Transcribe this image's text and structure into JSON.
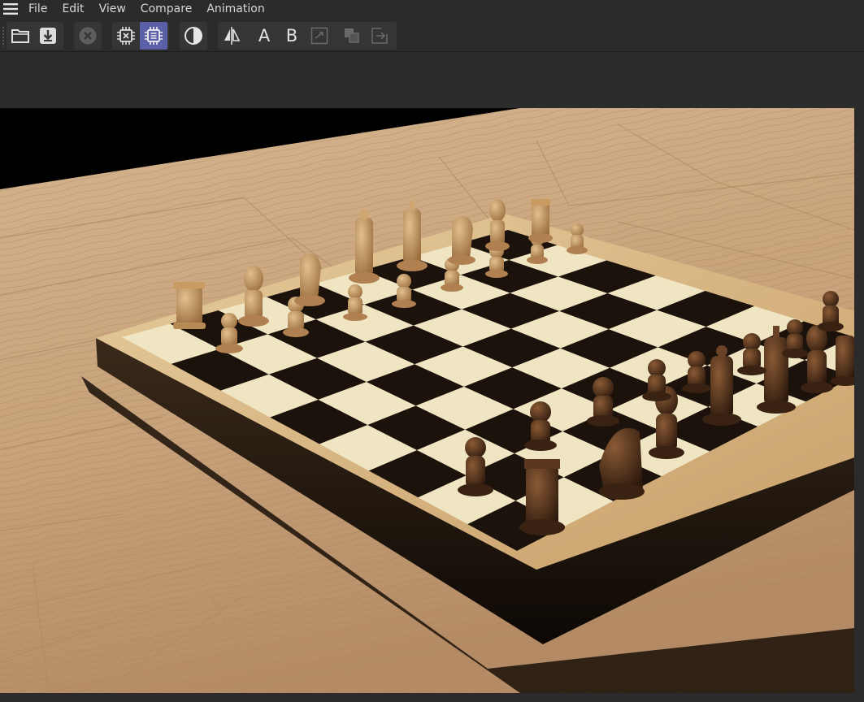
{
  "menu": {
    "items": [
      "File",
      "Edit",
      "View",
      "Compare",
      "Animation"
    ]
  },
  "toolbar": {
    "icons": {
      "menu": "hamburger-icon",
      "open": "folder-open-icon",
      "save": "download-icon",
      "stop": "stop-circle-icon",
      "cpu": "cpu-icon",
      "gpu": "chip-icon",
      "contrast": "contrast-icon",
      "compare": "compare-split-icon",
      "copy": "copy-icon",
      "export": "export-icon",
      "ab_swap": "swap-icon"
    },
    "label_a": "A",
    "label_b": "B"
  },
  "viewport": {
    "content": "render-image",
    "colors": {
      "floor": "#c9a37a",
      "board_light": "#efe5c2",
      "board_dark": "#1c120c",
      "frame": "#d8ba8a",
      "piece_light": "#b88a55",
      "piece_dark": "#4a2c18"
    }
  },
  "colors": {
    "ui_bg": "#2b2b2b",
    "button_bg": "#353535",
    "active": "#5a5fa8"
  }
}
